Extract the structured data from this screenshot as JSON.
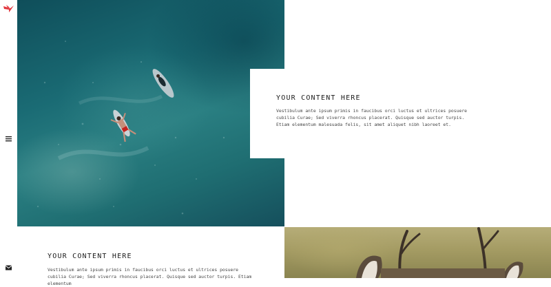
{
  "nav": {
    "logo": "bird-logo-icon",
    "menu_icon": "hamburger-menu-icon",
    "mail_icon": "mail-icon",
    "accent_color": "#e2383f"
  },
  "hero": {
    "photo": "aerial ocean surfers photo",
    "card": {
      "title": "YOUR CONTENT HERE",
      "body": "Vestibulum ante ipsum primis in faucibus orci luctus et ultrices posuere cubilia Curae; Sed viverra rhoncus placerat. Quisque sed auctor turpis. Etiam elementum malesuada felis, sit amet aliquet nibh laoreet et."
    }
  },
  "section2": {
    "title": "YOUR CONTENT HERE",
    "body": "Vestibulum ante ipsum primis in faucibus orci luctus et ultrices posuere cubilia Curae; Sed viverra rhoncus placerat. Quisque sed auctor turpis. Etiam elementum",
    "photo": "deer antlers photo"
  }
}
